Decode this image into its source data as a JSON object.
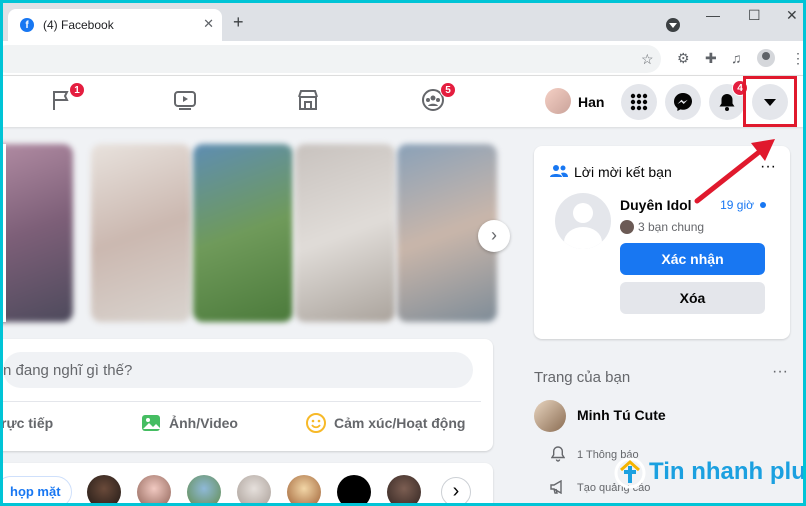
{
  "browser": {
    "tab_title": "(4) Facebook",
    "tab_favicon": "f",
    "close_tab": "✕",
    "new_tab": "+",
    "minimize": "—",
    "maximize": "☐",
    "close_window": "✕"
  },
  "nav": {
    "flag_badge": "1",
    "groups_badge": "5",
    "notif_badge": "4",
    "user_name": "Han"
  },
  "stories": {
    "next": "›"
  },
  "composer": {
    "placeholder": "n đang nghĩ gì thế?",
    "live": "rực tiếp",
    "photo": "Ảnh/Video",
    "feeling": "Cảm xúc/Hoạt động"
  },
  "rooms": {
    "create": "họp mặt",
    "next": "›"
  },
  "friend_request": {
    "header": "Lời mời kết bạn",
    "more": "···",
    "name": "Duyên Idol",
    "time": "19 giờ",
    "mutual": "3 bạn chung",
    "confirm": "Xác nhận",
    "delete": "Xóa"
  },
  "your_pages": {
    "header": "Trang của bạn",
    "more": "···",
    "page_name": "Minh Tú Cute",
    "notifications": "1 Thông báo",
    "create_ad": "Tạo quảng cáo"
  },
  "watermark": {
    "text": "Tin nhanh plus"
  },
  "colors": {
    "accent": "#1877f2",
    "badge": "#e41e3f",
    "highlight": "#e0192d",
    "border": "#00c4d6"
  }
}
